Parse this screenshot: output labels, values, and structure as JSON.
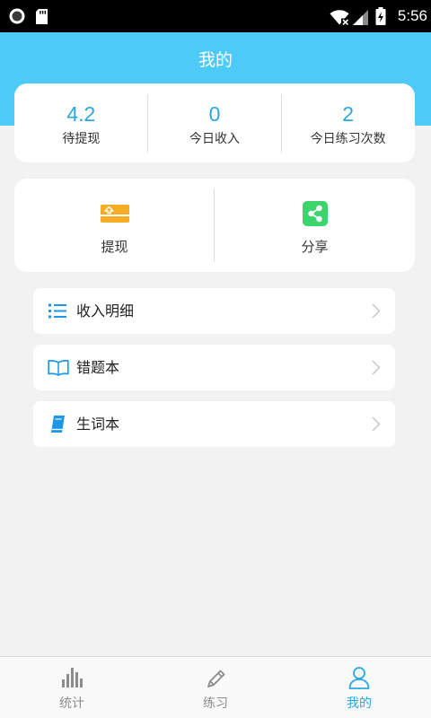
{
  "colors": {
    "status_bar": "#000000",
    "header_bg": "#4DCAF7",
    "page_bg": "#F2F2F2",
    "accent": "#2BA6E1",
    "menu_icon": "#1E98E6",
    "withdraw_icon": "#F6AD24",
    "share_icon": "#3ED46C",
    "tab_inactive": "#8C8C8C",
    "tab_active": "#2BA6E6"
  },
  "status_bar": {
    "time": "5:56",
    "left_icons": [
      "record-icon",
      "sd-card-icon"
    ],
    "right_icons": [
      "wifi-icon",
      "signal-icon",
      "battery-charging-icon"
    ]
  },
  "header": {
    "title": "我的"
  },
  "stats": [
    {
      "value": "4.2",
      "label": "待提现"
    },
    {
      "value": "0",
      "label": "今日收入"
    },
    {
      "value": "2",
      "label": "今日练习次数"
    }
  ],
  "actions": [
    {
      "label": "提现",
      "icon": "withdraw-icon"
    },
    {
      "label": "分享",
      "icon": "share-icon"
    }
  ],
  "menu": [
    {
      "label": "收入明细",
      "icon": "list-icon"
    },
    {
      "label": "错题本",
      "icon": "open-book-icon"
    },
    {
      "label": "生词本",
      "icon": "book-icon"
    }
  ],
  "tabbar": [
    {
      "label": "统计",
      "icon": "bar-chart-icon",
      "active": false
    },
    {
      "label": "练习",
      "icon": "pencil-icon",
      "active": false
    },
    {
      "label": "我的",
      "icon": "user-icon",
      "active": true
    }
  ]
}
